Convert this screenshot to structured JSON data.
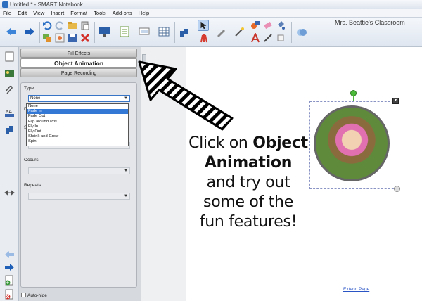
{
  "window": {
    "title": "Untitled * - SMART Notebook"
  },
  "menu": [
    "File",
    "Edit",
    "View",
    "Insert",
    "Format",
    "Tools",
    "Add-ons",
    "Help"
  ],
  "toolbar": {
    "classroom_label": "Mrs. Beattie's Classroom"
  },
  "panel": {
    "tabs": {
      "fill_effects": "Fill Effects",
      "object_animation": "Object Animation",
      "page_recording": "Page Recording"
    },
    "type_label": "Type",
    "type_value": "None",
    "direction_label": "Di",
    "speed_label": "Sp",
    "occurs_label": "Occurs",
    "repeats_label": "Repeats",
    "dropdown_options": [
      "None",
      "Fade In",
      "Fade Out",
      "Flip around axis",
      "Fly In",
      "Fly Out",
      "Shrink and Grow",
      "Spin"
    ],
    "selected_option": "Fade In",
    "autohide_label": "Auto-hide"
  },
  "canvas": {
    "instruction": {
      "line1": "Click on",
      "line1_bold": "Object",
      "line2_bold": "Animation",
      "line3": "and try out",
      "line4": "some of the",
      "line5": "fun features!"
    },
    "extend_page": "Extend Page",
    "menu_handle": "▾"
  },
  "colors": {
    "accent": "#3478d6",
    "rotate_handle": "#4cbb3a",
    "link": "#2a55c5"
  },
  "icons": [
    "back-arrow-icon",
    "forward-arrow-icon",
    "undo-icon",
    "redo-icon",
    "open-icon",
    "save-icon",
    "delete-icon",
    "paste-icon",
    "screen-shade-icon",
    "table-icon",
    "select-icon",
    "pen-icon",
    "magic-pen-icon",
    "shapes-icon",
    "eraser-icon",
    "line-icon",
    "text-icon",
    "fill-icon"
  ]
}
